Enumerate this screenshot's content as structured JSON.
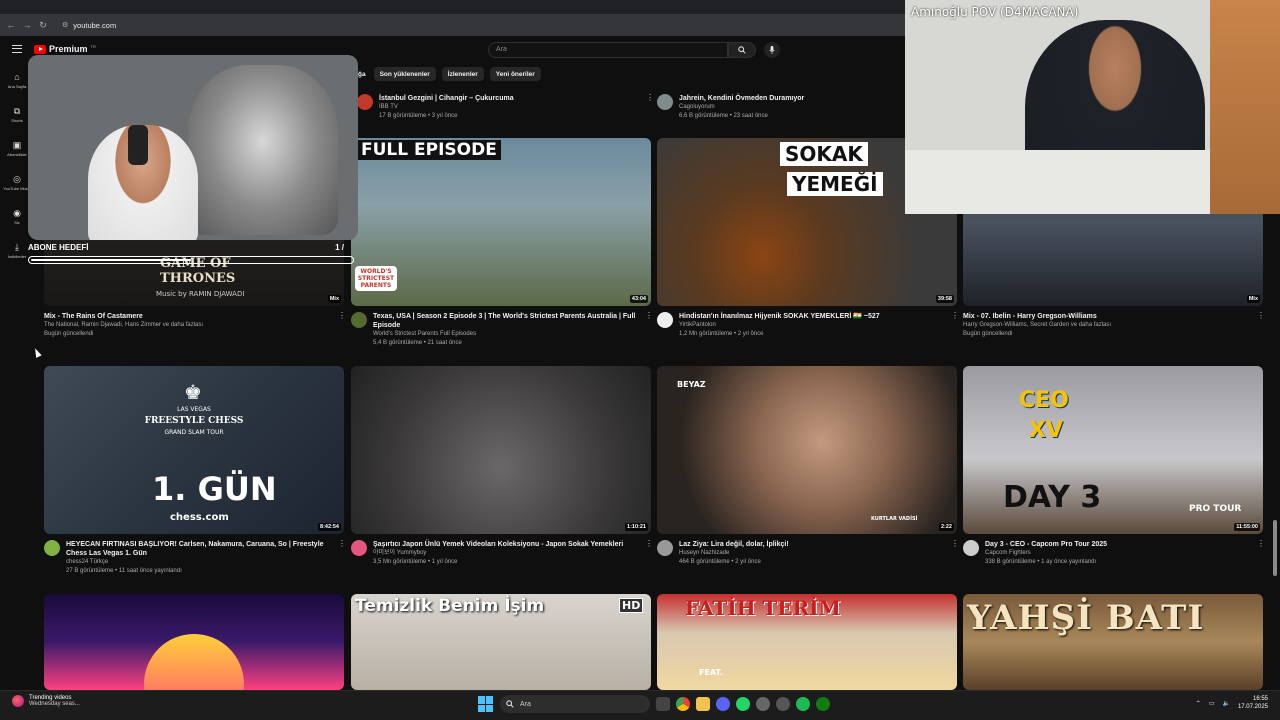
{
  "browser": {
    "url": "youtube.com"
  },
  "header": {
    "logo_text": "Premium",
    "logo_tm": "TR",
    "search_placeholder": "Ara"
  },
  "sidebar": {
    "items": [
      {
        "label": "Ana Sayfa",
        "icon": "home-icon"
      },
      {
        "label": "Shorts",
        "icon": "shorts-icon"
      },
      {
        "label": "Abonelikler",
        "icon": "subscriptions-icon"
      },
      {
        "label": "YouTube Music",
        "icon": "music-icon"
      },
      {
        "label": "Siz",
        "icon": "user-icon"
      },
      {
        "label": "İndirilenler",
        "icon": "download-icon"
      }
    ]
  },
  "chips": [
    "oğa",
    "Son yüklenenler",
    "İzlenenler",
    "Yeni öneriler"
  ],
  "row0": [
    {
      "title": "İstanbul Gezgini | Cihangir – Çukurcuma",
      "channel": "İBB TV",
      "stats": "17 B görüntüleme • 3 yıl önce"
    },
    {
      "title": "Jahrein, Kendini Övmeden Duramıyor",
      "channel": "Cagoluyorum",
      "stats": "6,6 B görüntüleme • 23 saat önce"
    }
  ],
  "row1": [
    {
      "title": "Mix - The Rains Of Castamere",
      "line2": "The National, Ramin Djawadi, Hans Zimmer ve daha fazlası",
      "line3": "Bugün güncellendi",
      "badge": "Mix",
      "thumb_text1": "GAME OF",
      "thumb_text2": "THRONES",
      "thumb_text3": "Music by RAMIN DJAWADI"
    },
    {
      "title": "Texas, USA | Season 2 Episode 3 | The World's Strictest Parents Australia | Full Episode",
      "line2": "World's Strictest Parents Full Episodes",
      "line3": "5,4 B görüntüleme • 21 saat önce",
      "duration": "43:04",
      "thumb_text1": "FULL EPISODE",
      "thumb_text2": "WORLD'S STRICTEST PARENTS"
    },
    {
      "title": "Hindistan'ın İnanılmaz Hijyenik SOKAK YEMEKLERİ 🇮🇳 ~527",
      "line2": "YirtikPantolon",
      "line3": "1,2 Mn görüntüleme • 2 yıl önce",
      "duration": "39:58",
      "thumb_text1": "SOKAK",
      "thumb_text2": "YEMEĞİ"
    },
    {
      "title": "Mix - 07. Ibelin - Harry Gregson-Williams",
      "line2": "Harry Gregson-Williams, Secret Garden ve daha fazlası",
      "line3": "Bugün güncellendi",
      "badge": "Mix"
    }
  ],
  "row2": [
    {
      "title": "HEYECAN FIRTINASI BAŞLIYOR! Carlsen, Nakamura, Caruana, So | Freestyle Chess Las Vegas 1. Gün",
      "line2": "chess24 Türkçe",
      "line3": "27 B görüntüleme • 11 saat önce yayınlandı",
      "duration": "8:42:54",
      "thumb_text1": "LAS VEGAS",
      "thumb_text2": "FREESTYLE CHESS",
      "thumb_text3": "GRAND SLAM TOUR",
      "thumb_text4": "1. GÜN",
      "thumb_text5": "chess.com"
    },
    {
      "title": "Şaşırtıcı Japon Ünlü Yemek Videoları Koleksiyonu - Japon Sokak Yemekleri",
      "line2": "야미보이 Yummyboy",
      "line3": "3,5 Mn görüntüleme • 1 yıl önce",
      "duration": "1:10:21"
    },
    {
      "title": "Laz Ziya: Lira değil, dolar, İplikçi!",
      "line2": "Huseyn Nazhizade",
      "line3": "464 B görüntüleme • 2 yıl önce",
      "duration": "2:22",
      "thumb_text1": "BEYAZ",
      "thumb_text2": "KURTLAR VADİSİ"
    },
    {
      "title": "Day 3 - CEO - Capcom Pro Tour 2025",
      "line2": "Capcom Fighters",
      "line3": "338 B görüntüleme • 1 ay önce yayınlandı",
      "duration": "11:55:00",
      "thumb_text1": "CEO",
      "thumb_text2": "XV",
      "thumb_text3": "DAY 3",
      "thumb_text4": "PRO TOUR"
    }
  ],
  "row3": [
    {
      "thumb_text1": ""
    },
    {
      "thumb_text1": "Temizlik Benim İşim",
      "thumb_text2": "HD"
    },
    {
      "thumb_text1": "FATİH TERİM",
      "thumb_text2": "FEAT."
    },
    {
      "thumb_text1": "YAHŞİ BATI"
    }
  ],
  "overlay": {
    "cam_right_label": "Amınoğlu POV (D4MACANA)",
    "goal_label": "ABONE HEDEFİ",
    "goal_count": "1 /",
    "goal_fraction": 0.5
  },
  "taskbar": {
    "news_title": "Trending videos",
    "news_sub": "Wednesday seas...",
    "search": "Ara",
    "time": "16:55",
    "date": "17.07.2025"
  }
}
